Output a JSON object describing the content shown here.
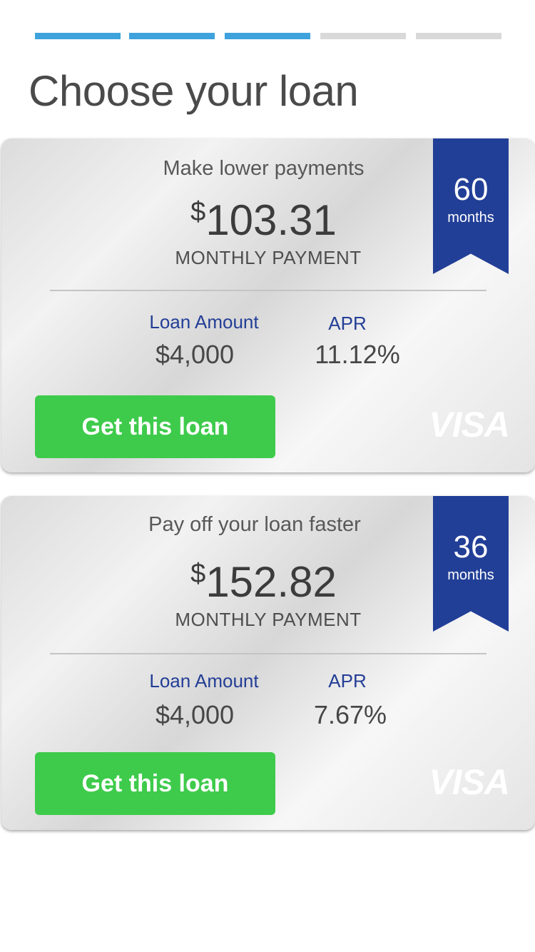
{
  "progress": {
    "total_steps": 5,
    "completed_steps": 3,
    "accent_color": "#3ea3dc",
    "inactive_color": "#d9d9d9"
  },
  "page_title": "Choose your loan",
  "loan_options": [
    {
      "heading": "Make lower payments",
      "currency_symbol": "$",
      "monthly_payment": "103.31",
      "payment_label": "MONTHLY PAYMENT",
      "term_number": "60",
      "term_unit": "months",
      "loan_amount_label": "Loan Amount",
      "loan_amount": "$4,000",
      "apr_label": "APR",
      "apr": "11.12%",
      "button_label": "Get this loan",
      "card_brand": "VISA"
    },
    {
      "heading": "Pay off your loan faster",
      "currency_symbol": "$",
      "monthly_payment": "152.82",
      "payment_label": "MONTHLY PAYMENT",
      "term_number": "36",
      "term_unit": "months",
      "loan_amount_label": "Loan Amount",
      "loan_amount": "$4,000",
      "apr_label": "APR",
      "apr": "7.67%",
      "button_label": "Get this loan",
      "card_brand": "VISA"
    }
  ],
  "colors": {
    "button": "#3ecb4b",
    "ribbon": "#223f97",
    "stat_label": "#233e96"
  },
  "icons": {
    "card_brand_logo": "visa-logo"
  }
}
